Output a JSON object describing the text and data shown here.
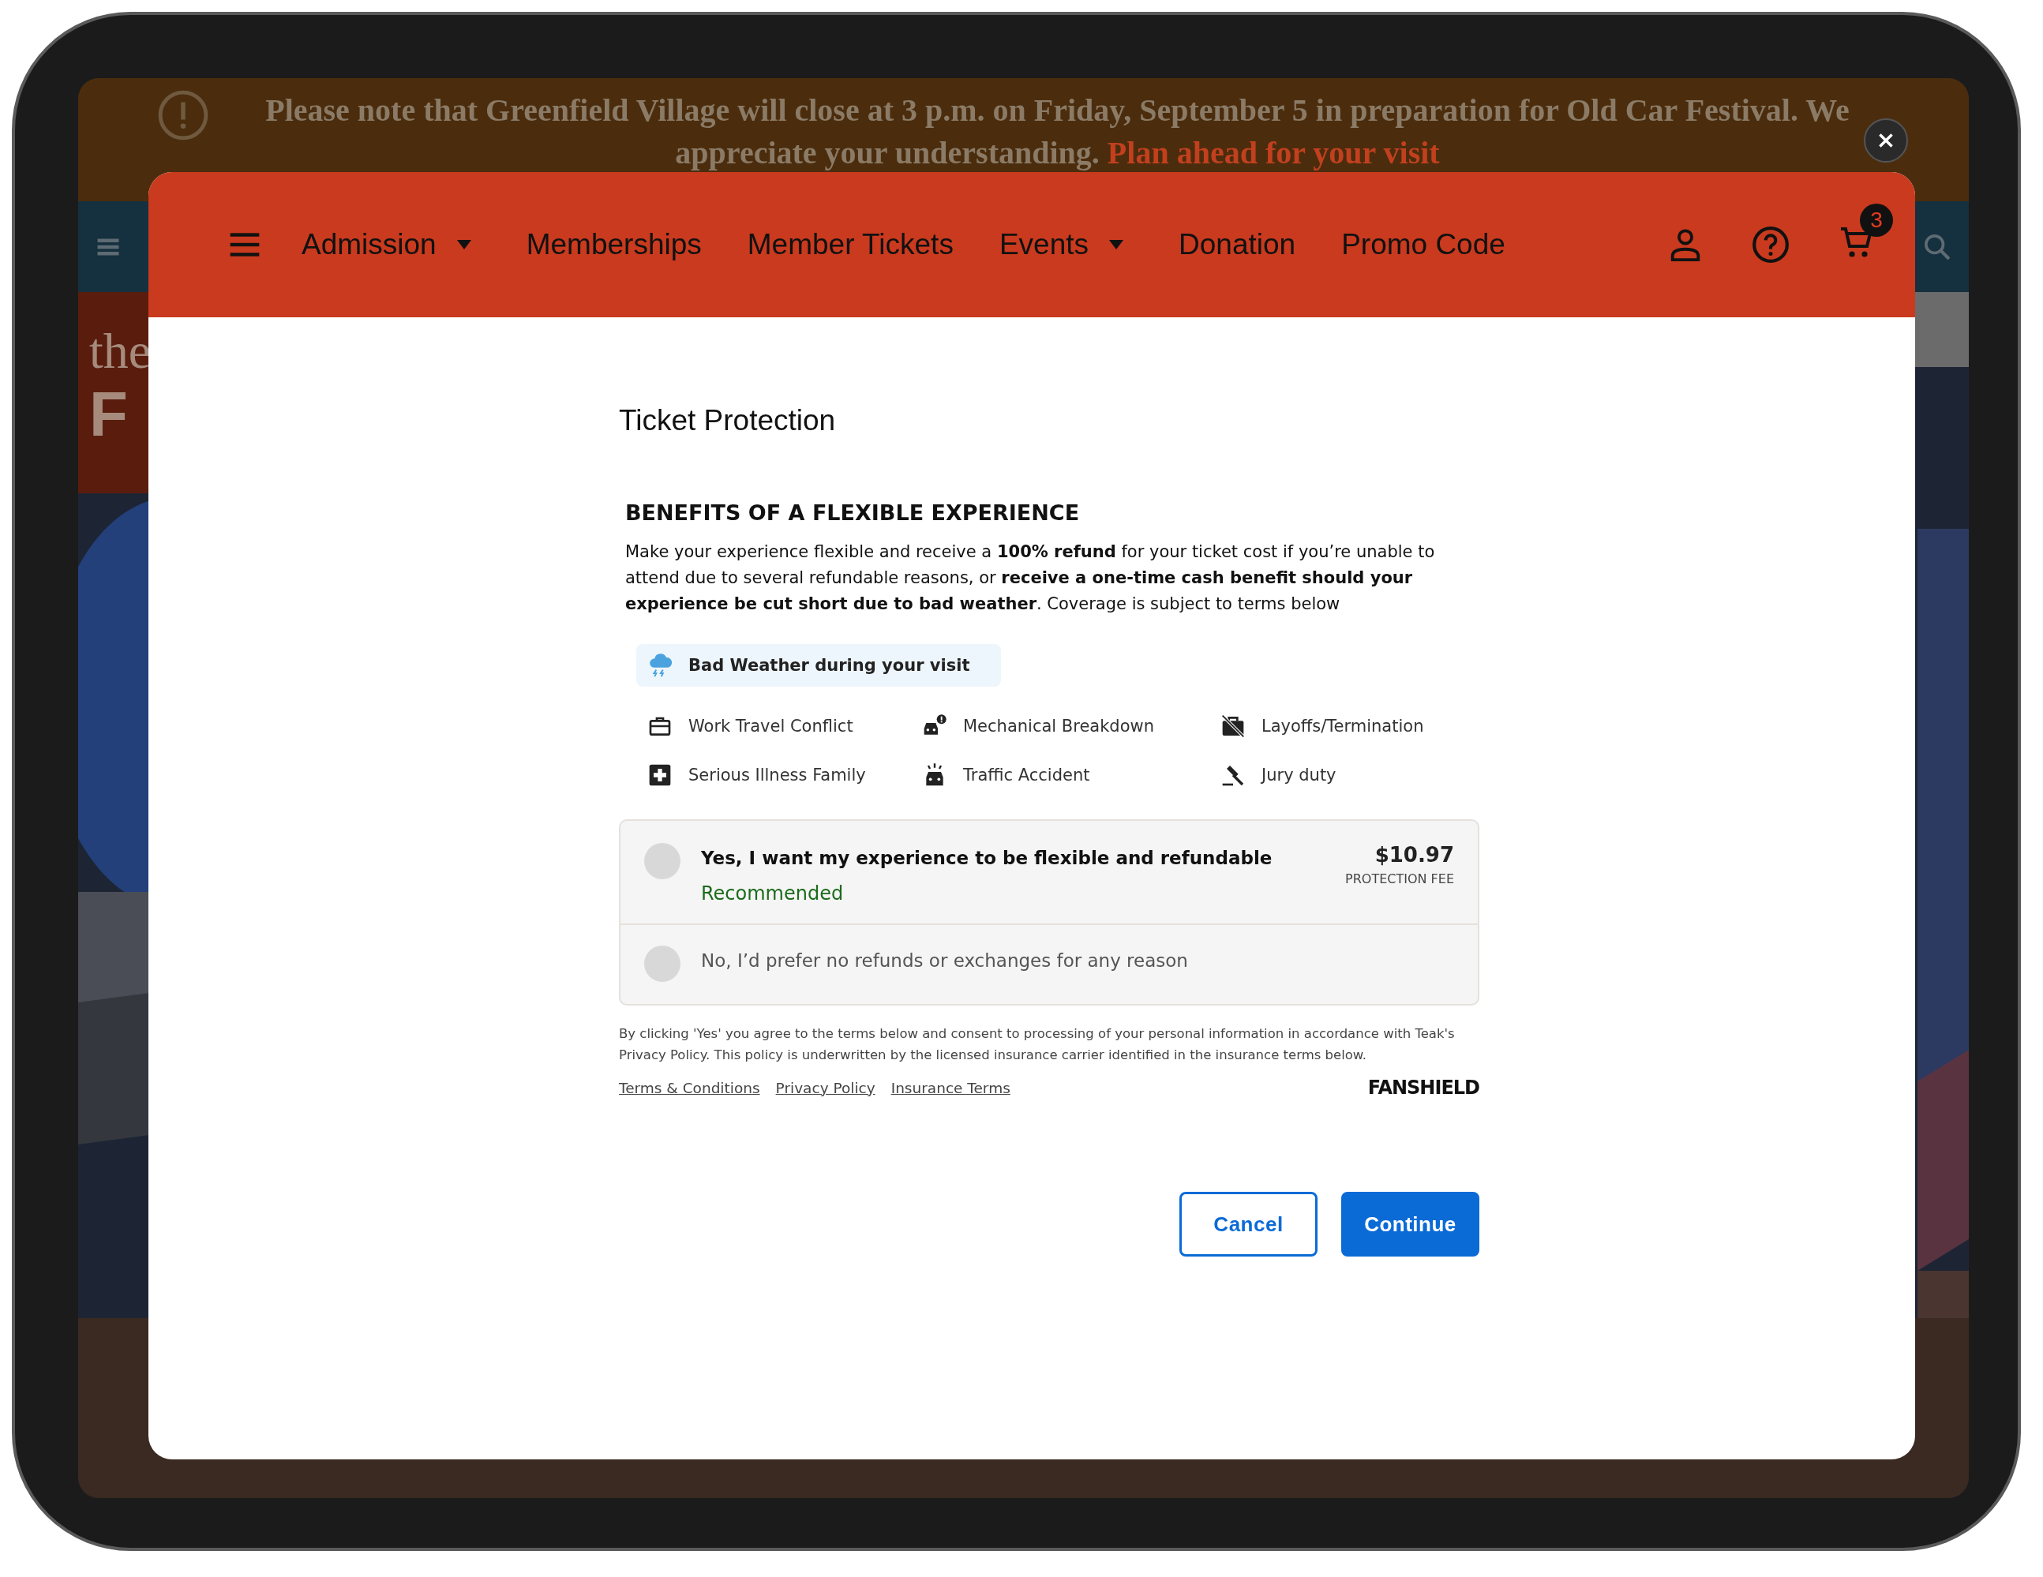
{
  "announcement": {
    "lines": [
      "Please note that Greenfield Village will close at 3 p.m. on Friday, September 5 in preparation for Old Car Festival. We",
      "appreciate your understanding."
    ],
    "link": "Plan ahead for your visit"
  },
  "hero": {
    "texts": [
      "the",
      "F"
    ]
  },
  "modal": {
    "nav": {
      "items": [
        {
          "label": "Admission",
          "dropdown": true
        },
        {
          "label": "Memberships",
          "dropdown": false
        },
        {
          "label": "Member Tickets",
          "dropdown": false
        },
        {
          "label": "Events",
          "dropdown": true
        },
        {
          "label": "Donation",
          "dropdown": false
        },
        {
          "label": "Promo Code",
          "dropdown": false
        }
      ],
      "cart_count": "3"
    },
    "title": "Ticket Protection",
    "heading": "BENEFITS OF A FLEXIBLE EXPERIENCE",
    "description": "Make your experience flexible and receive a **100% refund** for your ticket cost if you’re unable to attend due to several refundable reasons, or **receive a one-time cash benefit should your experience be cut short due to bad weather**. Coverage is subject to terms below",
    "highlight": {
      "label": "Bad Weather during your visit"
    },
    "benefits": [
      {
        "label": "Work Travel Conflict",
        "kind": "briefcase"
      },
      {
        "label": "Mechanical Breakdown",
        "kind": "car-alert"
      },
      {
        "label": "Layoffs/Termination",
        "kind": "briefcase-off"
      },
      {
        "label": "Serious Illness Family",
        "kind": "medical"
      },
      {
        "label": "Traffic Accident",
        "kind": "car-accident"
      },
      {
        "label": "Jury duty",
        "kind": "gavel"
      }
    ],
    "options": [
      {
        "kind": "accept",
        "label": "Yes, I want my experience to be flexible and refundable",
        "note": "Recommended",
        "price": "$10.97",
        "price_label": "PROTECTION FEE",
        "selected": false
      },
      {
        "kind": "decline",
        "label": "No, I’d prefer no refunds or exchanges for any reason",
        "selected": false
      }
    ],
    "disclaimer": "By clicking 'Yes' you agree to the terms below and consent to processing of your personal information in accordance with Teak's Privacy Policy. This policy is underwritten by the licensed insurance carrier identified in the insurance terms below.",
    "links": [
      "Terms & Conditions",
      "Privacy Policy",
      "Insurance Terms"
    ],
    "brand": "FANSHIELD",
    "buttons": [
      {
        "label": "Cancel",
        "kind": "secondary"
      },
      {
        "label": "Continue",
        "kind": "primary"
      }
    ]
  }
}
